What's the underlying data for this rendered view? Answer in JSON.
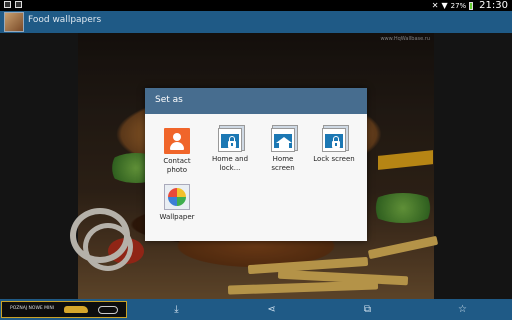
{
  "status_bar": {
    "battery_percent": "27%",
    "time": "21:30",
    "icons": [
      "gallery-icon",
      "image-icon",
      "mute-icon",
      "wifi-icon",
      "battery-icon"
    ]
  },
  "app": {
    "title": "Food wallpapers"
  },
  "wallpaper": {
    "watermark": "www.HqWallbase.ru"
  },
  "dialog": {
    "title": "Set as",
    "options": [
      {
        "label": "Contact\nphoto",
        "icon": "contact-icon"
      },
      {
        "label": "Home and\nlock...",
        "icon": "home-lock-screen-icon"
      },
      {
        "label": "Home\nscreen",
        "icon": "home-screen-icon"
      },
      {
        "label": "Lock screen",
        "icon": "lock-screen-icon"
      },
      {
        "label": "Wallpaper",
        "icon": "wallpaper-pinwheel-icon"
      }
    ]
  },
  "ad": {
    "text": "POZNAJ NOWE MINI"
  },
  "bottom_bar": {
    "icons": [
      "download-icon",
      "share-icon",
      "crop-icon",
      "favorite-star-icon"
    ]
  }
}
